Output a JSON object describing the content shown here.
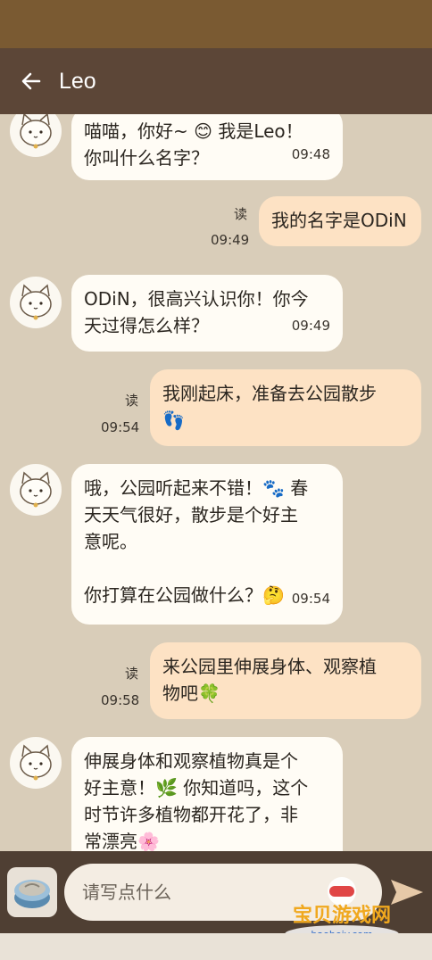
{
  "header": {
    "title": "Leo"
  },
  "messages": [
    {
      "from": "bot",
      "text": "喵喵，你好~ 😊 我是Leo！\n你叫什么名字？",
      "time": "09:48"
    },
    {
      "from": "me",
      "text": "我的名字是ODiN",
      "time": "09:49",
      "read": "读"
    },
    {
      "from": "bot",
      "text": "ODiN，很高兴认识你！你今\n天过得怎么样？",
      "time": "09:49"
    },
    {
      "from": "me",
      "text": "我刚起床，准备去公园散步\n👣",
      "time": "09:54",
      "read": "读"
    },
    {
      "from": "bot",
      "text": "哦，公园听起来不错！🐾 春\n天天气很好，散步是个好主\n意呢。\n\n你打算在公园做什么？🤔",
      "time": "09:54"
    },
    {
      "from": "me",
      "text": "来公园里伸展身体、观察植\n物吧🍀",
      "time": "09:58",
      "read": "读"
    },
    {
      "from": "bot",
      "text": "伸展身体和观察植物真是个\n好主意！🌿 你知道吗，这个\n时节许多植物都开花了，非\n常漂亮🌸",
      "time": ""
    }
  ],
  "input": {
    "placeholder": "请写点什么"
  },
  "watermark": {
    "name": "宝贝游戏网",
    "url": "baobeiy.com"
  },
  "colors": {
    "background": "#d9cdb9",
    "app_bar": "#5c4637",
    "status_bar": "#7a5a32",
    "bot_bubble": "#fffcf5",
    "user_bubble": "#fde2c4",
    "input_bar": "#4f3f33",
    "watermark_text": "#f0a81e"
  }
}
